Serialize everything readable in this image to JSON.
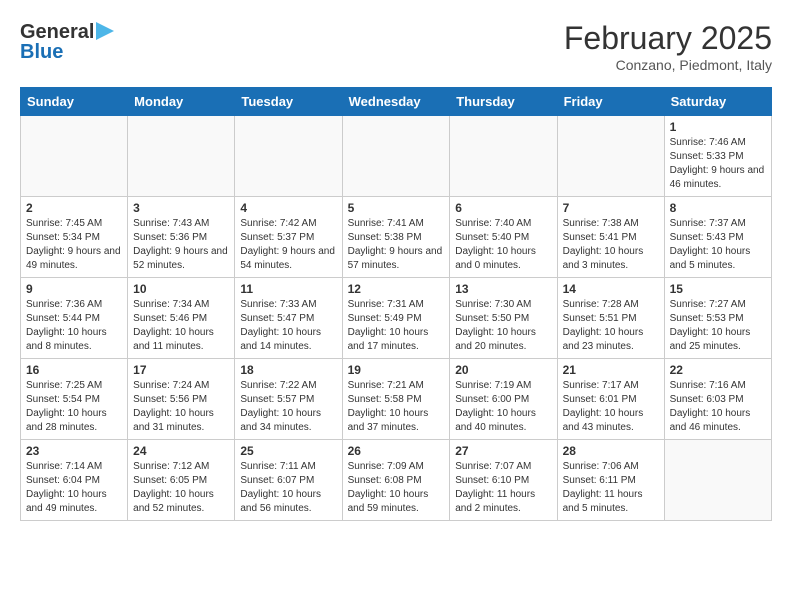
{
  "header": {
    "logo_general": "General",
    "logo_blue": "Blue",
    "month_title": "February 2025",
    "location": "Conzano, Piedmont, Italy"
  },
  "days_of_week": [
    "Sunday",
    "Monday",
    "Tuesday",
    "Wednesday",
    "Thursday",
    "Friday",
    "Saturday"
  ],
  "weeks": [
    [
      {
        "day": "",
        "info": ""
      },
      {
        "day": "",
        "info": ""
      },
      {
        "day": "",
        "info": ""
      },
      {
        "day": "",
        "info": ""
      },
      {
        "day": "",
        "info": ""
      },
      {
        "day": "",
        "info": ""
      },
      {
        "day": "1",
        "info": "Sunrise: 7:46 AM\nSunset: 5:33 PM\nDaylight: 9 hours and 46 minutes."
      }
    ],
    [
      {
        "day": "2",
        "info": "Sunrise: 7:45 AM\nSunset: 5:34 PM\nDaylight: 9 hours and 49 minutes."
      },
      {
        "day": "3",
        "info": "Sunrise: 7:43 AM\nSunset: 5:36 PM\nDaylight: 9 hours and 52 minutes."
      },
      {
        "day": "4",
        "info": "Sunrise: 7:42 AM\nSunset: 5:37 PM\nDaylight: 9 hours and 54 minutes."
      },
      {
        "day": "5",
        "info": "Sunrise: 7:41 AM\nSunset: 5:38 PM\nDaylight: 9 hours and 57 minutes."
      },
      {
        "day": "6",
        "info": "Sunrise: 7:40 AM\nSunset: 5:40 PM\nDaylight: 10 hours and 0 minutes."
      },
      {
        "day": "7",
        "info": "Sunrise: 7:38 AM\nSunset: 5:41 PM\nDaylight: 10 hours and 3 minutes."
      },
      {
        "day": "8",
        "info": "Sunrise: 7:37 AM\nSunset: 5:43 PM\nDaylight: 10 hours and 5 minutes."
      }
    ],
    [
      {
        "day": "9",
        "info": "Sunrise: 7:36 AM\nSunset: 5:44 PM\nDaylight: 10 hours and 8 minutes."
      },
      {
        "day": "10",
        "info": "Sunrise: 7:34 AM\nSunset: 5:46 PM\nDaylight: 10 hours and 11 minutes."
      },
      {
        "day": "11",
        "info": "Sunrise: 7:33 AM\nSunset: 5:47 PM\nDaylight: 10 hours and 14 minutes."
      },
      {
        "day": "12",
        "info": "Sunrise: 7:31 AM\nSunset: 5:49 PM\nDaylight: 10 hours and 17 minutes."
      },
      {
        "day": "13",
        "info": "Sunrise: 7:30 AM\nSunset: 5:50 PM\nDaylight: 10 hours and 20 minutes."
      },
      {
        "day": "14",
        "info": "Sunrise: 7:28 AM\nSunset: 5:51 PM\nDaylight: 10 hours and 23 minutes."
      },
      {
        "day": "15",
        "info": "Sunrise: 7:27 AM\nSunset: 5:53 PM\nDaylight: 10 hours and 25 minutes."
      }
    ],
    [
      {
        "day": "16",
        "info": "Sunrise: 7:25 AM\nSunset: 5:54 PM\nDaylight: 10 hours and 28 minutes."
      },
      {
        "day": "17",
        "info": "Sunrise: 7:24 AM\nSunset: 5:56 PM\nDaylight: 10 hours and 31 minutes."
      },
      {
        "day": "18",
        "info": "Sunrise: 7:22 AM\nSunset: 5:57 PM\nDaylight: 10 hours and 34 minutes."
      },
      {
        "day": "19",
        "info": "Sunrise: 7:21 AM\nSunset: 5:58 PM\nDaylight: 10 hours and 37 minutes."
      },
      {
        "day": "20",
        "info": "Sunrise: 7:19 AM\nSunset: 6:00 PM\nDaylight: 10 hours and 40 minutes."
      },
      {
        "day": "21",
        "info": "Sunrise: 7:17 AM\nSunset: 6:01 PM\nDaylight: 10 hours and 43 minutes."
      },
      {
        "day": "22",
        "info": "Sunrise: 7:16 AM\nSunset: 6:03 PM\nDaylight: 10 hours and 46 minutes."
      }
    ],
    [
      {
        "day": "23",
        "info": "Sunrise: 7:14 AM\nSunset: 6:04 PM\nDaylight: 10 hours and 49 minutes."
      },
      {
        "day": "24",
        "info": "Sunrise: 7:12 AM\nSunset: 6:05 PM\nDaylight: 10 hours and 52 minutes."
      },
      {
        "day": "25",
        "info": "Sunrise: 7:11 AM\nSunset: 6:07 PM\nDaylight: 10 hours and 56 minutes."
      },
      {
        "day": "26",
        "info": "Sunrise: 7:09 AM\nSunset: 6:08 PM\nDaylight: 10 hours and 59 minutes."
      },
      {
        "day": "27",
        "info": "Sunrise: 7:07 AM\nSunset: 6:10 PM\nDaylight: 11 hours and 2 minutes."
      },
      {
        "day": "28",
        "info": "Sunrise: 7:06 AM\nSunset: 6:11 PM\nDaylight: 11 hours and 5 minutes."
      },
      {
        "day": "",
        "info": ""
      }
    ]
  ]
}
